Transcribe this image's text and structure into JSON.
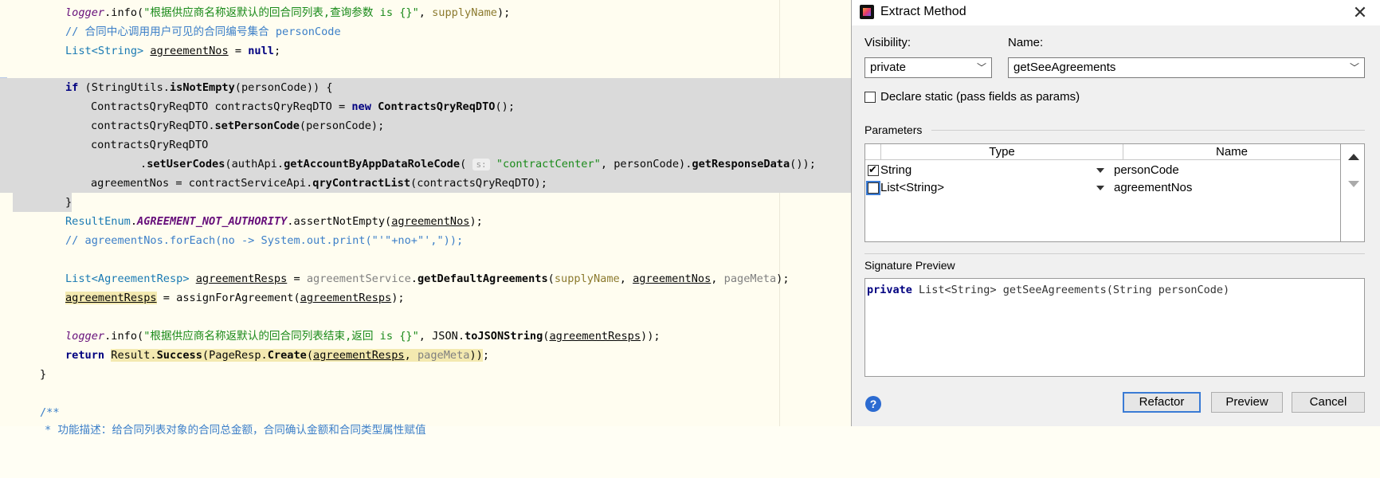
{
  "editor": {
    "lines": [
      {
        "text": "logger.info(\"根据供应商名称返默认的回合同列表,查询参数 is {}\", supplyName);"
      },
      {
        "text": "// 合同中心调用用户可见的合同编号集合 personCode"
      },
      {
        "text": "List<String> agreementNos = null;"
      },
      {
        "text": ""
      },
      {
        "text": "if (StringUtils.isNotEmpty(personCode)) {"
      },
      {
        "text": "ContractsQryReqDTO contractsQryReqDTO = new ContractsQryReqDTO();"
      },
      {
        "text": "contractsQryReqDTO.setPersonCode(personCode);"
      },
      {
        "text": "contractsQryReqDTO"
      },
      {
        "text": ".setUserCodes(authApi.getAccountByAppDataRoleCode("
      },
      {
        "text": "agreementNos = contractServiceApi.qryContractList(contractsQryReqDTO);"
      },
      {
        "text": "}"
      },
      {
        "text": "ResultEnum.AGREEMENT_NOT_AUTHORITY.assertNotEmpty(agreementNos);"
      },
      {
        "text": "// agreementNos.forEach(no -> System.out.print(\"'\"+no+\"',\"));"
      },
      {
        "text": ""
      },
      {
        "text": "List<AgreementResp> agreementResps = agreementService.getDefaultAgreements(supplyName, agreementNos, pageMeta);"
      },
      {
        "text": "agreementResps = assignForAgreement(agreementResps);"
      },
      {
        "text": ""
      },
      {
        "text": "logger.info(\"根据供应商名称返默认的回合同列表结束,返回 is {}\", JSON.toJSONString(agreementResps));"
      },
      {
        "text": "return Result.Success(PageResp.Create(agreementResps, pageMeta));"
      },
      {
        "text": "}"
      },
      {
        "text": ""
      },
      {
        "text": "/**"
      },
      {
        "text": "* 功能描述：给合同列表对象的合同总金额，合同确认金额和合同类型属性赋值"
      }
    ],
    "inlay_hint": "s:",
    "hint_args": "\"contractCenter\", personCode).getResponseData());"
  },
  "dialog": {
    "title": "Extract Method",
    "visibility_label": "Visibility:",
    "visibility_value": "private",
    "name_label": "Name:",
    "name_value": "getSeeAgreements",
    "declare_static_label": "Declare static (pass fields as params)",
    "declare_static_checked": false,
    "parameters_label": "Parameters",
    "columns": [
      "Type",
      "Name"
    ],
    "params": [
      {
        "type": "String",
        "name": "personCode",
        "checked": true
      },
      {
        "type": "List<String>",
        "name": "agreementNos",
        "checked": false
      }
    ],
    "signature_label": "Signature Preview",
    "signature_kw": "private",
    "signature_rest": " List<String> getSeeAgreements(String personCode)",
    "help": "?",
    "buttons": {
      "refactor": "Refactor",
      "preview": "Preview",
      "cancel": "Cancel"
    },
    "colors": {
      "accent": "#3a7bd5",
      "selection": "#dadada"
    },
    "icons": [
      "app-icon",
      "close-icon",
      "chevron-down-icon",
      "dropdown-triangle-icon",
      "move-up-icon",
      "move-down-icon",
      "help-icon"
    ]
  }
}
